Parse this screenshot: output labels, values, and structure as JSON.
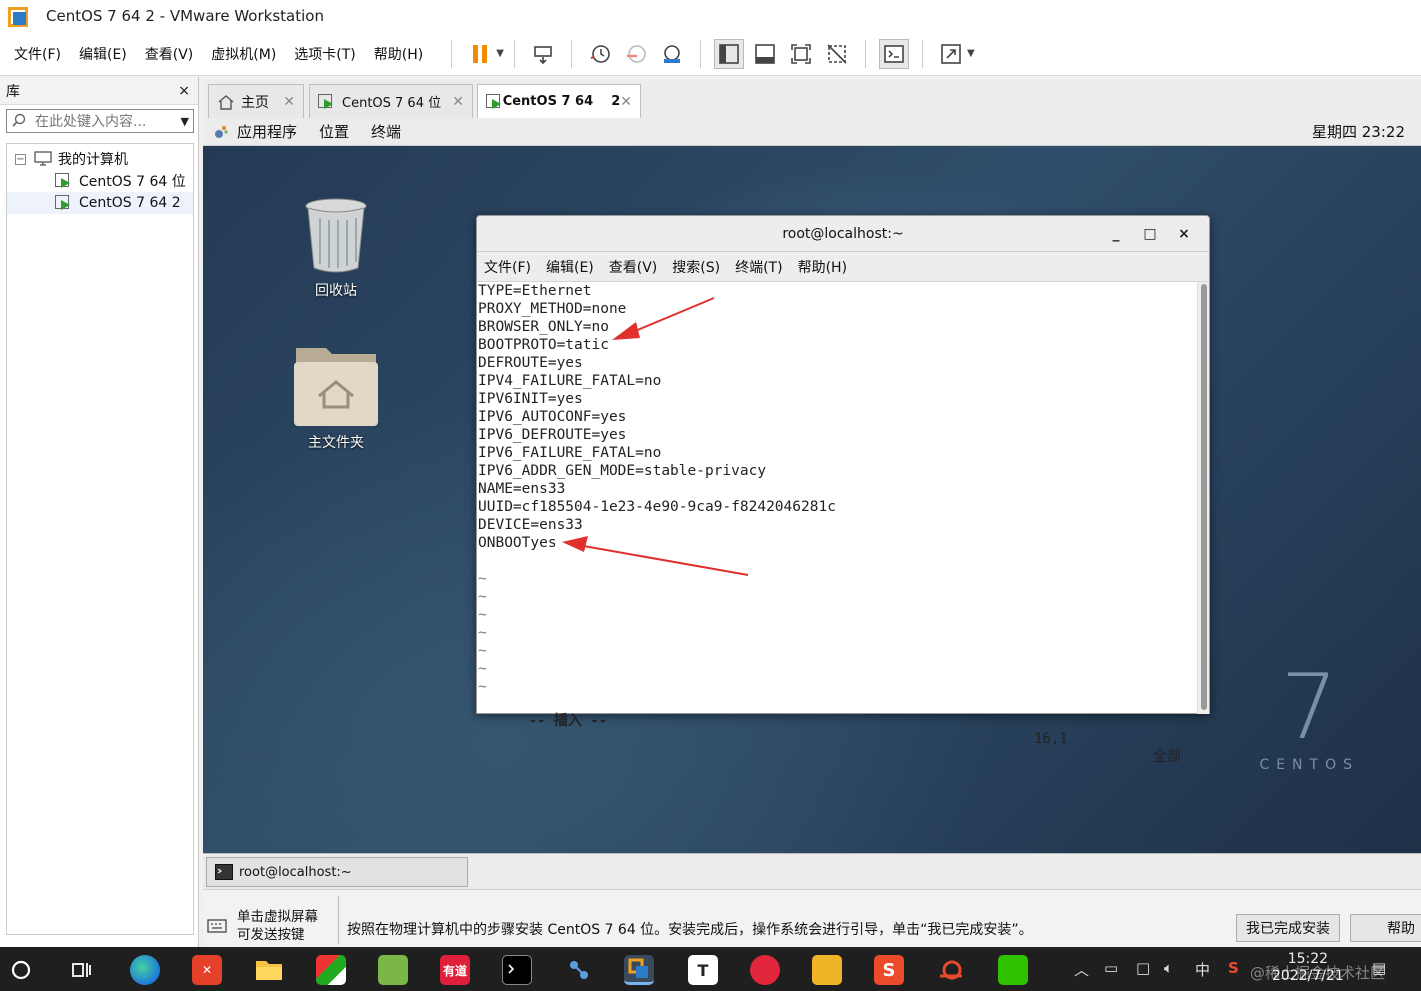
{
  "window": {
    "title": "CentOS 7 64   2 - VMware Workstation"
  },
  "menu": [
    "文件(F)",
    "编辑(E)",
    "查看(V)",
    "虚拟机(M)",
    "选项卡(T)",
    "帮助(H)"
  ],
  "library": {
    "title": "库",
    "close": "×",
    "search_placeholder": "在此处键入内容...",
    "root": "我的计算机",
    "items": [
      "CentOS 7 64 位",
      "CentOS 7 64   2"
    ]
  },
  "tabs": [
    {
      "label": "主页"
    },
    {
      "label": "CentOS 7 64 位"
    },
    {
      "label": "CentOS 7 64    2"
    }
  ],
  "gnome": {
    "apps": "应用程序",
    "places": "位置",
    "terminal": "终端",
    "clock": "星期四 23:22"
  },
  "desktop": {
    "trash": "回收站",
    "home": "主文件夹",
    "logo_number": "7",
    "logo_word": "CENTOS"
  },
  "terminal": {
    "title": "root@localhost:~",
    "controls": [
      "_",
      "□",
      "×"
    ],
    "menu": [
      "文件(F)",
      "编辑(E)",
      "查看(V)",
      "搜索(S)",
      "终端(T)",
      "帮助(H)"
    ],
    "lines": [
      "TYPE=Ethernet",
      "PROXY_METHOD=none",
      "BROWSER_ONLY=no",
      "BOOTPROTO=tatic",
      "DEFROUTE=yes",
      "IPV4_FAILURE_FATAL=no",
      "IPV6INIT=yes",
      "IPV6_AUTOCONF=yes",
      "IPV6_DEFROUTE=yes",
      "IPV6_FAILURE_FATAL=no",
      "IPV6_ADDR_GEN_MODE=stable-privacy",
      "NAME=ens33",
      "UUID=cf185504-1e23-4e90-9ca9-f8242046281c",
      "DEVICE=ens33",
      "ONBOOTyes",
      ""
    ],
    "tilde": "~",
    "mode": "-- 插入 --",
    "position": "16,1",
    "scope": "全部"
  },
  "vm_taskbar": {
    "item": "root@localhost:~"
  },
  "infobar": {
    "hint_line1": "单击虚拟屏幕",
    "hint_line2": "可发送按键",
    "message": "按照在物理计算机中的步骤安装 CentOS 7 64 位。安装完成后，操作系统会进行引导，单击“我已完成安装”。",
    "done_button": "我已完成安装",
    "help_button": "帮助"
  },
  "win_taskbar": {
    "time": "15:22",
    "date": "2022/7/21",
    "ime": "中",
    "youdao": "有道",
    "watermark": "@稀土掘金技术社区"
  },
  "colors": {
    "arrow": "#e0302e",
    "desktop": "#2f4d6a",
    "accent": "#2a7cc9"
  }
}
